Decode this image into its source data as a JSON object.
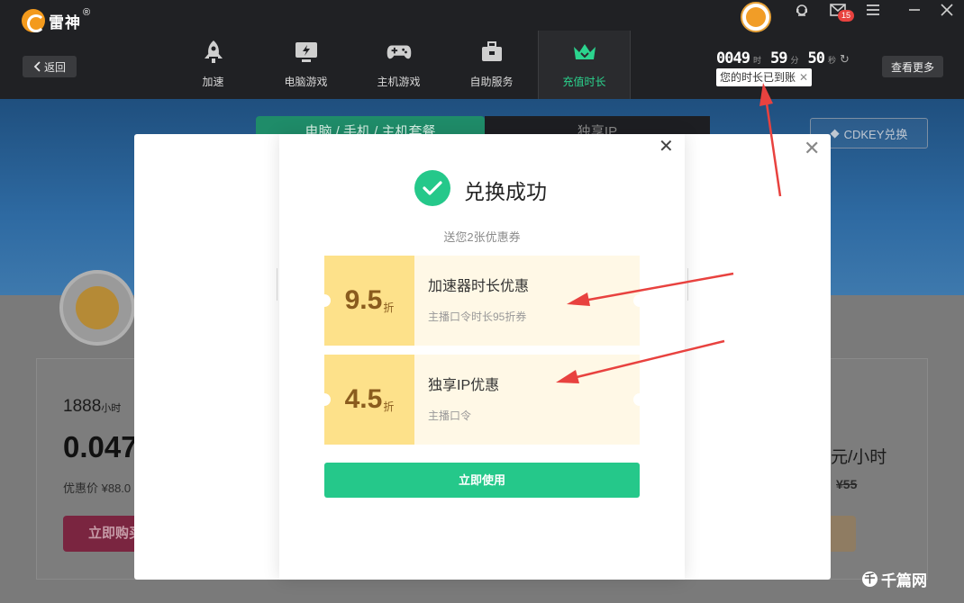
{
  "app": {
    "logo_text": "雷神",
    "logo_reg": "®",
    "mail_badge": "15"
  },
  "header": {
    "back_label": "返回",
    "nav": [
      {
        "label": "加速",
        "icon": "rocket-icon"
      },
      {
        "label": "电脑游戏",
        "icon": "monitor-icon"
      },
      {
        "label": "主机游戏",
        "icon": "gamepad-icon"
      },
      {
        "label": "自助服务",
        "icon": "toolbox-icon"
      },
      {
        "label": "充值时长",
        "icon": "crown-icon",
        "active": true
      }
    ],
    "timer": {
      "hours": "0049",
      "hours_unit": "时",
      "minutes": "59",
      "minutes_unit": "分",
      "seconds": "50",
      "seconds_unit": "秒"
    },
    "tooltip": "您的时长已到账",
    "more_label": "查看更多"
  },
  "background": {
    "tab1": "电脑 / 手机 / 主机套餐",
    "tab2": "独享IP",
    "cdkey_label": "CDKEY兑换",
    "left_card": {
      "hours": "1888",
      "hours_unit": "小时",
      "price": "0.047",
      "discount": "优惠价 ¥88.0",
      "buy": "立即购买"
    },
    "right_card": {
      "price": "元/小时",
      "orig": "¥55"
    }
  },
  "modal": {
    "title": "兑换成功",
    "subtitle": "送您2张优惠券",
    "coupons": [
      {
        "value": "9.5",
        "unit": "折",
        "name": "加速器时长优惠",
        "desc": "主播口令时长95折券"
      },
      {
        "value": "4.5",
        "unit": "折",
        "name": "独享IP优惠",
        "desc": "主播口令"
      }
    ],
    "use_button": "立即使用"
  },
  "watermark": {
    "text": "千篇网",
    "icon": "千"
  },
  "colors": {
    "accent": "#25c88a",
    "topbar": "#202124",
    "coupon_left": "#fde18a",
    "coupon_right": "#fff8e6",
    "arrow": "#e8423f"
  }
}
